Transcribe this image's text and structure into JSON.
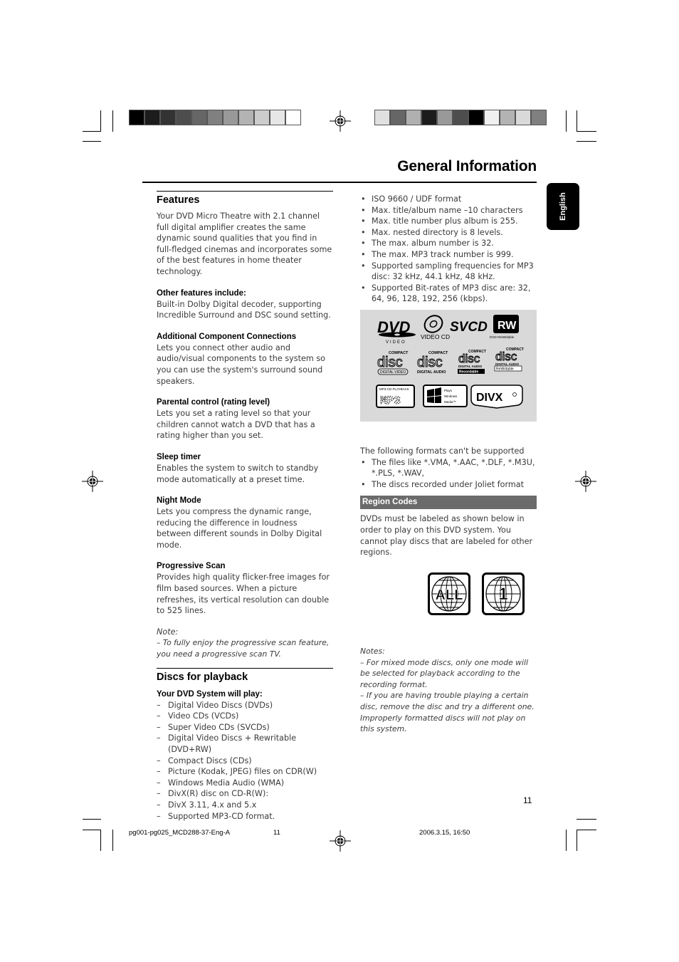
{
  "header": {
    "title": "General Information",
    "language_tab": "English",
    "left_swatches": [
      "#000000",
      "#1c1c1c",
      "#333333",
      "#4d4d4d",
      "#666666",
      "#808080",
      "#999999",
      "#b3b3b3",
      "#cccccc",
      "#e6e6e6",
      "#ffffff"
    ],
    "right_swatches": [
      "#e0e0e0",
      "#666666",
      "#b0b0b0",
      "#1c1c1c",
      "#999999",
      "#4d4d4d",
      "#000000",
      "#f0f0f0",
      "#b3b3b3",
      "#d9d9d9",
      "#808080"
    ]
  },
  "left_column": {
    "features": {
      "title": "Features",
      "intro": "Your DVD Micro Theatre with 2.1 channel full digital amplifier creates the same dynamic sound qualities that you find in full-fledged cinemas and incorporates some of the best features in home theater technology.",
      "items": [
        {
          "heading": "Other features include:",
          "text": "Built-in Dolby Digital decoder, supporting Incredible Surround and DSC sound setting."
        },
        {
          "heading": "Additional Component Connections",
          "text": "Lets you connect other audio and audio/visual components to the system so you can use the system's surround sound speakers."
        },
        {
          "heading": "Parental control (rating level)",
          "text": "Lets you set a rating level so that your children cannot watch a DVD that has a rating higher than you set."
        },
        {
          "heading": "Sleep timer",
          "text": "Enables the system to switch to standby mode automatically at a preset time."
        },
        {
          "heading": "Night Mode",
          "text": "Lets you compress the dynamic range, reducing the difference in loudness between different sounds in Dolby Digital mode."
        },
        {
          "heading": "Progressive Scan",
          "text": "Provides high quality flicker-free images for film based sources. When a picture refreshes, its vertical resolution can double to 525 lines."
        }
      ],
      "note_label": "Note:",
      "note_text": "–  To fully enjoy the progressive scan feature, you need a progressive scan TV."
    },
    "discs": {
      "title": "Discs for playback",
      "subtitle": "Your DVD System will play:",
      "items": [
        "Digital Video Discs (DVDs)",
        "Video CDs (VCDs)",
        "Super Video CDs (SVCDs)",
        "Digital Video Discs + Rewritable (DVD+RW)",
        "Compact Discs (CDs)",
        "Picture (Kodak, JPEG) files on CDR(W)",
        "Windows Media Audio (WMA)",
        "DivX(R) disc on CD-R(W):",
        "DivX 3.11, 4.x and 5.x",
        "Supported MP3-CD format."
      ]
    }
  },
  "right_column": {
    "mp3_specs": [
      "ISO 9660 / UDF format",
      "Max. title/album name –10 characters",
      "Max. title number plus album is 255.",
      "Max. nested directory is 8 levels.",
      "The max. album number is 32.",
      "The max. MP3 track number is 999.",
      "Supported sampling frequencies for MP3 disc:  32 kHz, 44.1 kHz, 48 kHz.",
      "Supported Bit-rates of MP3 disc are: 32, 64, 96, 128, 192, 256 (kbps)."
    ],
    "logos": {
      "dvd_video": {
        "main": "DVD",
        "sub": "VIDEO"
      },
      "video_cd": "VIDEO CD",
      "svcd": "SVCD",
      "rw": {
        "main": "RW",
        "sub": "DVD+ReWritable"
      },
      "cd_digital_video": {
        "top": "COMPACT",
        "main": "disc",
        "sub": "DIGITAL VIDEO"
      },
      "cd_digital_audio": {
        "top": "COMPACT",
        "main": "disc",
        "sub": "DIGITAL AUDIO"
      },
      "cd_recordable": {
        "top": "COMPACT",
        "main": "disc",
        "sub": "DIGITAL AUDIO",
        "tag": "Recordable"
      },
      "cd_rewritable": {
        "top": "COMPACT",
        "main": "disc",
        "sub": "DIGITAL AUDIO",
        "tag": "ReWritable"
      },
      "mp3_cd": {
        "top": "MP3-CD PLAYBACK",
        "main": "MP3"
      },
      "windows_media": {
        "line1": "Plays",
        "line2": "Windows",
        "line3": "Media™"
      },
      "divx": "DIVX"
    },
    "unsupported": {
      "intro": "The following formats can't be supported",
      "items": [
        "The files like *.VMA, *.AAC, *.DLF, *.M3U, *.PLS, *.WAV,",
        "The discs recorded under Joliet format"
      ]
    },
    "region": {
      "title": "Region Codes",
      "text": "DVDs must be labeled as shown below in order to play on this DVD system. You cannot play discs that are labeled for other regions.",
      "badges": [
        "ALL",
        "1"
      ]
    },
    "notes": {
      "label": "Notes:",
      "items": [
        "–  For mixed mode discs, only one mode will be selected for playback according to the recording format.",
        "–  If you are having trouble playing a certain disc, remove the disc and try a different one. Improperly formatted discs will not play on this system."
      ]
    }
  },
  "footer": {
    "page_number": "11",
    "file_name": "pg001-pg025_MCD288-37-Eng-A",
    "file_page": "11",
    "timestamp": "2006.3.15, 16:50"
  }
}
